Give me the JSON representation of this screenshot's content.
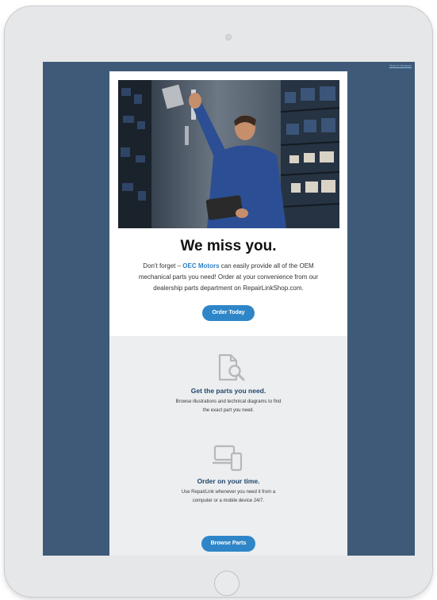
{
  "header": {
    "view_in_browser": "View in browser"
  },
  "hero": {
    "image_alt": "Mechanic with tablet reaching for parts on warehouse shelves"
  },
  "intro": {
    "headline": "We miss you.",
    "text_before": "Don't forget – ",
    "brand": "OEC Motors",
    "text_after": " can easily provide all of the OEM mechanical parts you need! Order at your convenience from our dealership parts department on RepairLinkShop.com.",
    "cta_label": "Order Today"
  },
  "features": [
    {
      "icon": "document-search-icon",
      "title": "Get the parts you need.",
      "description": "Browse illustrations and technical diagrams to find the exact part you need."
    },
    {
      "icon": "devices-icon",
      "title": "Order on your time.",
      "description": "Use RepairLink whenever you need it from a computer or a mobile device 24/7."
    }
  ],
  "footer_cta": {
    "label": "Browse Parts"
  },
  "colors": {
    "screen_background": "#3f5a78",
    "accent_blue": "#2e86c8",
    "feature_title": "#21466f",
    "section_gray": "#eceeef"
  }
}
